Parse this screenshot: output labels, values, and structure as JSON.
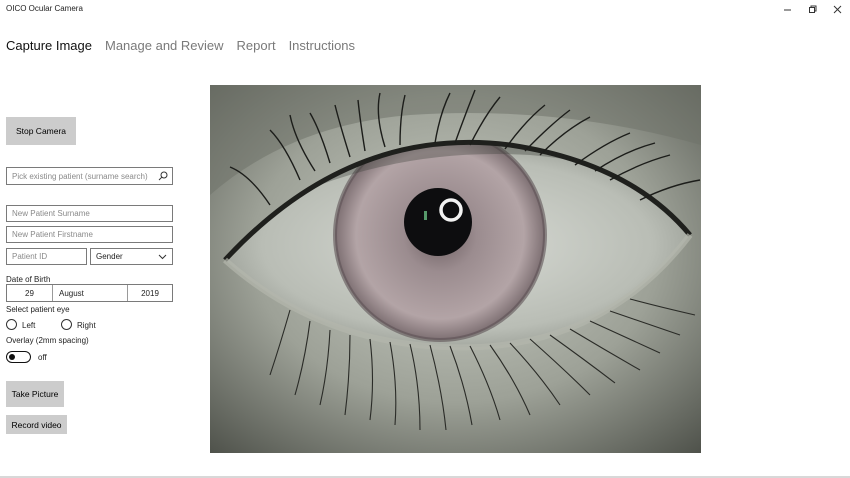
{
  "app": {
    "title": "OICO Ocular Camera"
  },
  "window_controls": {
    "minimize": "—",
    "maximize": "❐",
    "close": "✕"
  },
  "nav": {
    "tabs": [
      "Capture Image",
      "Manage and Review",
      "Report",
      "Instructions"
    ],
    "active": 0
  },
  "left_panel": {
    "stop_camera": "Stop Camera",
    "search": {
      "placeholder": "Pick existing patient (surname search)"
    },
    "new_surname": {
      "placeholder": "New Patient Surname"
    },
    "new_firstname": {
      "placeholder": "New Patient Firstname"
    },
    "patient_id": {
      "placeholder": "Patient ID"
    },
    "gender": {
      "selected": "Gender"
    },
    "dob": {
      "label": "Date of Birth",
      "day": "29",
      "month": "August",
      "year": "2019"
    },
    "eye": {
      "label": "Select patient eye",
      "left": "Left",
      "right": "Right"
    },
    "overlay": {
      "label": "Overlay (2mm spacing)",
      "state": "off"
    },
    "take_picture": "Take Picture",
    "record_video": "Record video"
  },
  "colors": {
    "button_bg": "#cccccc",
    "tab_active": "#111111",
    "tab_inactive": "#7a7a7a"
  }
}
